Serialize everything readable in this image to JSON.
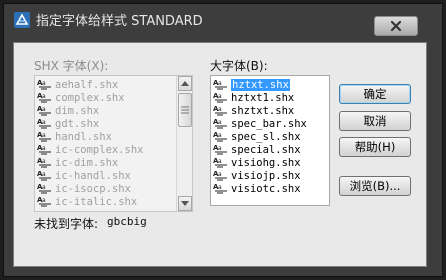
{
  "window": {
    "title": "指定字体给样式 STANDARD",
    "close_symbol": "X",
    "icons": {
      "app": "autocad-app-icon",
      "close": "close-icon",
      "font_file": "shx-font-file-icon"
    }
  },
  "shx_panel": {
    "label": "SHX 字体(X):",
    "items": [
      "aehalf.shx",
      "complex.shx",
      "dim.shx",
      "gdt.shx",
      "handl.shx",
      "ic-complex.shx",
      "ic-dim.shx",
      "ic-handl.shx",
      "ic-isocp.shx",
      "ic-italic.shx"
    ]
  },
  "bigfont_panel": {
    "label": "大字体(B):",
    "items": [
      "hztxt.shx",
      "hztxt1.shx",
      "shztxt.shx",
      "spec_bar.shx",
      "spec_sl.shx",
      "special.shx",
      "visiohg.shx",
      "visiojp.shx",
      "visiotc.shx"
    ],
    "selected_index": 0
  },
  "buttons": {
    "ok": "确定",
    "cancel": "取消",
    "help": "帮助(H)",
    "browse": "浏览(B)..."
  },
  "status": {
    "not_found_label": "未找到字体:",
    "not_found_value": "gbcbig"
  },
  "colors": {
    "selection": "#3399ff",
    "window_frame": "#3d3d3d",
    "dialog_bg": "#e9e9e9"
  }
}
